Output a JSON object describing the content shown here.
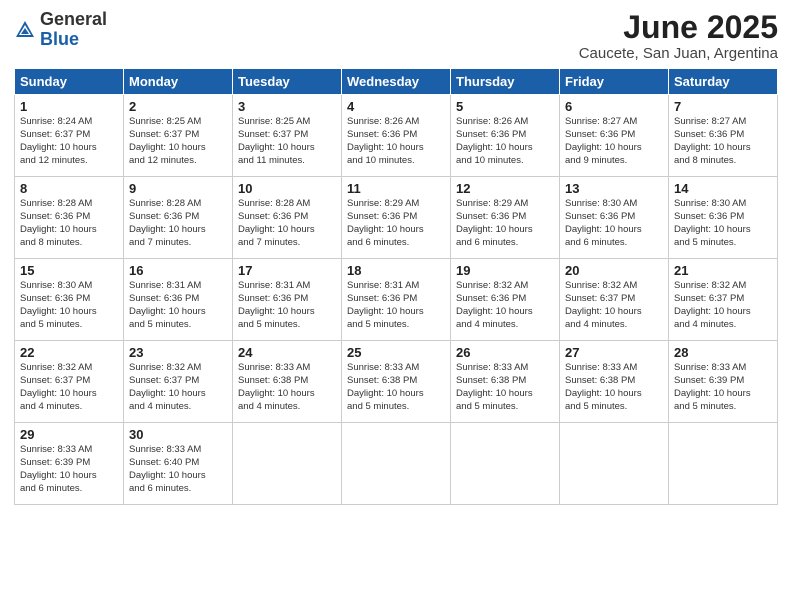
{
  "logo": {
    "general": "General",
    "blue": "Blue"
  },
  "title": "June 2025",
  "subtitle": "Caucete, San Juan, Argentina",
  "weekdays": [
    "Sunday",
    "Monday",
    "Tuesday",
    "Wednesday",
    "Thursday",
    "Friday",
    "Saturday"
  ],
  "weeks": [
    [
      {
        "day": "1",
        "info": "Sunrise: 8:24 AM\nSunset: 6:37 PM\nDaylight: 10 hours\nand 12 minutes."
      },
      {
        "day": "2",
        "info": "Sunrise: 8:25 AM\nSunset: 6:37 PM\nDaylight: 10 hours\nand 12 minutes."
      },
      {
        "day": "3",
        "info": "Sunrise: 8:25 AM\nSunset: 6:37 PM\nDaylight: 10 hours\nand 11 minutes."
      },
      {
        "day": "4",
        "info": "Sunrise: 8:26 AM\nSunset: 6:36 PM\nDaylight: 10 hours\nand 10 minutes."
      },
      {
        "day": "5",
        "info": "Sunrise: 8:26 AM\nSunset: 6:36 PM\nDaylight: 10 hours\nand 10 minutes."
      },
      {
        "day": "6",
        "info": "Sunrise: 8:27 AM\nSunset: 6:36 PM\nDaylight: 10 hours\nand 9 minutes."
      },
      {
        "day": "7",
        "info": "Sunrise: 8:27 AM\nSunset: 6:36 PM\nDaylight: 10 hours\nand 8 minutes."
      }
    ],
    [
      {
        "day": "8",
        "info": "Sunrise: 8:28 AM\nSunset: 6:36 PM\nDaylight: 10 hours\nand 8 minutes."
      },
      {
        "day": "9",
        "info": "Sunrise: 8:28 AM\nSunset: 6:36 PM\nDaylight: 10 hours\nand 7 minutes."
      },
      {
        "day": "10",
        "info": "Sunrise: 8:28 AM\nSunset: 6:36 PM\nDaylight: 10 hours\nand 7 minutes."
      },
      {
        "day": "11",
        "info": "Sunrise: 8:29 AM\nSunset: 6:36 PM\nDaylight: 10 hours\nand 6 minutes."
      },
      {
        "day": "12",
        "info": "Sunrise: 8:29 AM\nSunset: 6:36 PM\nDaylight: 10 hours\nand 6 minutes."
      },
      {
        "day": "13",
        "info": "Sunrise: 8:30 AM\nSunset: 6:36 PM\nDaylight: 10 hours\nand 6 minutes."
      },
      {
        "day": "14",
        "info": "Sunrise: 8:30 AM\nSunset: 6:36 PM\nDaylight: 10 hours\nand 5 minutes."
      }
    ],
    [
      {
        "day": "15",
        "info": "Sunrise: 8:30 AM\nSunset: 6:36 PM\nDaylight: 10 hours\nand 5 minutes."
      },
      {
        "day": "16",
        "info": "Sunrise: 8:31 AM\nSunset: 6:36 PM\nDaylight: 10 hours\nand 5 minutes."
      },
      {
        "day": "17",
        "info": "Sunrise: 8:31 AM\nSunset: 6:36 PM\nDaylight: 10 hours\nand 5 minutes."
      },
      {
        "day": "18",
        "info": "Sunrise: 8:31 AM\nSunset: 6:36 PM\nDaylight: 10 hours\nand 5 minutes."
      },
      {
        "day": "19",
        "info": "Sunrise: 8:32 AM\nSunset: 6:36 PM\nDaylight: 10 hours\nand 4 minutes."
      },
      {
        "day": "20",
        "info": "Sunrise: 8:32 AM\nSunset: 6:37 PM\nDaylight: 10 hours\nand 4 minutes."
      },
      {
        "day": "21",
        "info": "Sunrise: 8:32 AM\nSunset: 6:37 PM\nDaylight: 10 hours\nand 4 minutes."
      }
    ],
    [
      {
        "day": "22",
        "info": "Sunrise: 8:32 AM\nSunset: 6:37 PM\nDaylight: 10 hours\nand 4 minutes."
      },
      {
        "day": "23",
        "info": "Sunrise: 8:32 AM\nSunset: 6:37 PM\nDaylight: 10 hours\nand 4 minutes."
      },
      {
        "day": "24",
        "info": "Sunrise: 8:33 AM\nSunset: 6:38 PM\nDaylight: 10 hours\nand 4 minutes."
      },
      {
        "day": "25",
        "info": "Sunrise: 8:33 AM\nSunset: 6:38 PM\nDaylight: 10 hours\nand 5 minutes."
      },
      {
        "day": "26",
        "info": "Sunrise: 8:33 AM\nSunset: 6:38 PM\nDaylight: 10 hours\nand 5 minutes."
      },
      {
        "day": "27",
        "info": "Sunrise: 8:33 AM\nSunset: 6:38 PM\nDaylight: 10 hours\nand 5 minutes."
      },
      {
        "day": "28",
        "info": "Sunrise: 8:33 AM\nSunset: 6:39 PM\nDaylight: 10 hours\nand 5 minutes."
      }
    ],
    [
      {
        "day": "29",
        "info": "Sunrise: 8:33 AM\nSunset: 6:39 PM\nDaylight: 10 hours\nand 6 minutes."
      },
      {
        "day": "30",
        "info": "Sunrise: 8:33 AM\nSunset: 6:40 PM\nDaylight: 10 hours\nand 6 minutes."
      },
      null,
      null,
      null,
      null,
      null
    ]
  ]
}
